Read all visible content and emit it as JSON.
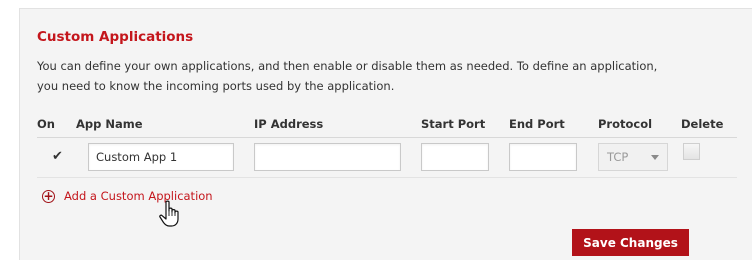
{
  "section": {
    "title": "Custom Applications",
    "description": "You can define your own applications, and then enable or disable them as needed. To define an application, you need to know the incoming ports used by the application."
  },
  "table": {
    "headers": {
      "on": "On",
      "app_name": "App Name",
      "ip_address": "IP Address",
      "start_port": "Start Port",
      "end_port": "End Port",
      "protocol": "Protocol",
      "delete": "Delete"
    },
    "rows": [
      {
        "enabled": "✔",
        "app_name": "Custom App 1",
        "ip_address": "",
        "start_port": "",
        "end_port": "",
        "protocol": "TCP",
        "delete": false
      }
    ]
  },
  "actions": {
    "add_label": "Add a Custom Application",
    "add_icon": "plus-circle-icon",
    "save_label": "Save Changes"
  },
  "colors": {
    "accent": "#c4161c",
    "button": "#b21219",
    "panel_bg": "#f4f4f4"
  }
}
